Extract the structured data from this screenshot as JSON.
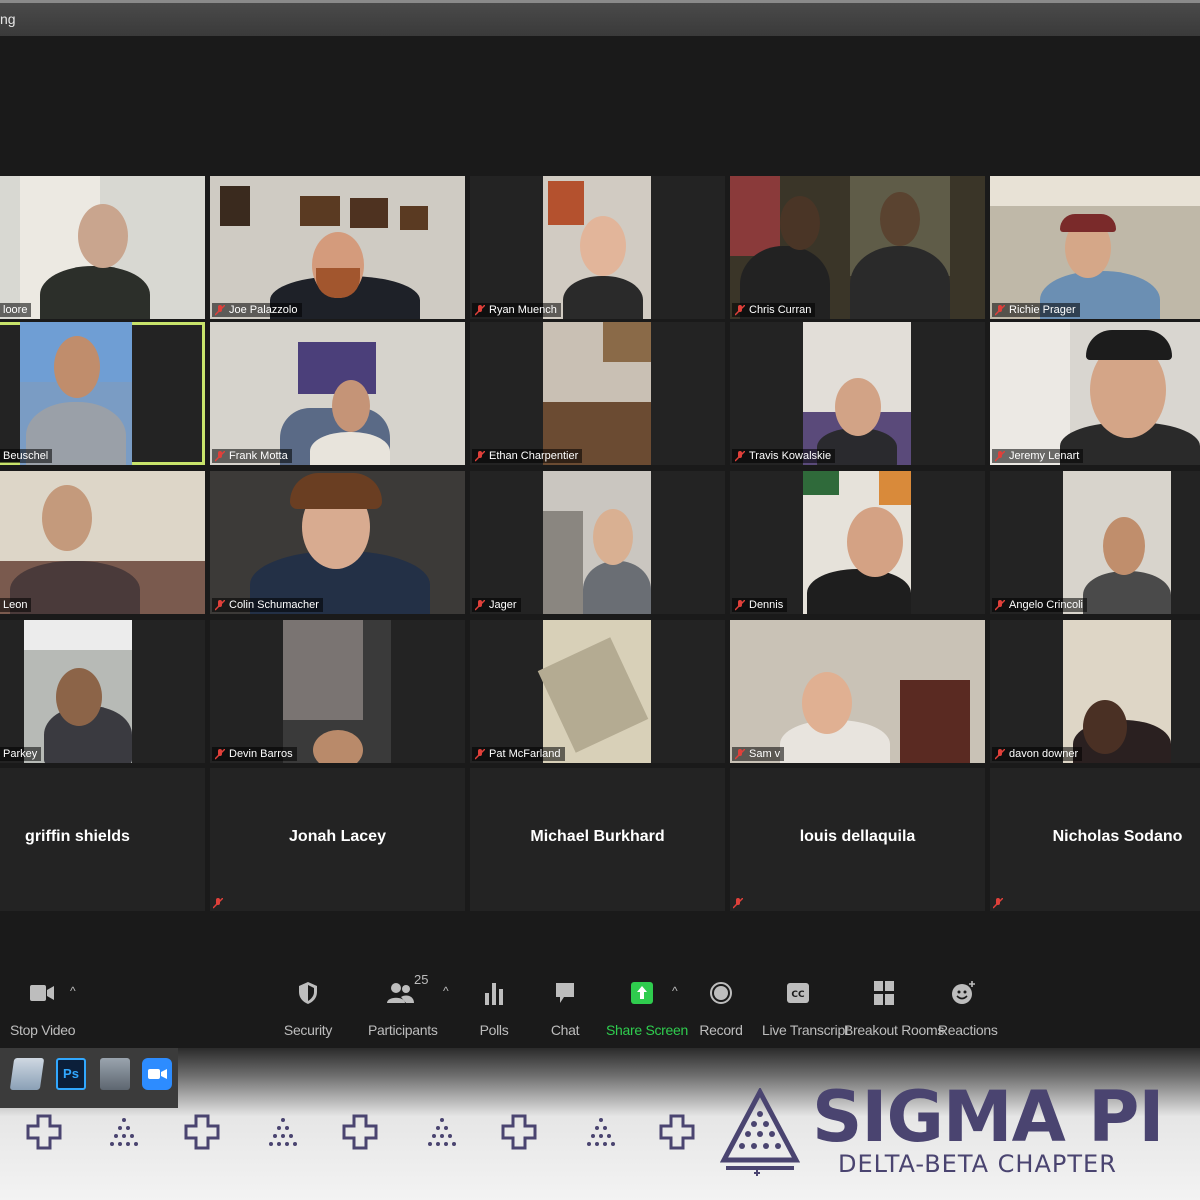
{
  "window": {
    "title": "ng"
  },
  "participants": [
    {
      "name": "loore"
    },
    {
      "name": "Joe Palazzolo"
    },
    {
      "name": "Ryan Muench"
    },
    {
      "name": "Chris Curran"
    },
    {
      "name": "Richie Prager"
    },
    {
      "name": "Beuschel"
    },
    {
      "name": "Frank Motta"
    },
    {
      "name": "Ethan Charpentier"
    },
    {
      "name": "Travis Kowalskie"
    },
    {
      "name": "Jeremy Lenart"
    },
    {
      "name": "Leon"
    },
    {
      "name": "Colin Schumacher"
    },
    {
      "name": "Jager"
    },
    {
      "name": "Dennis"
    },
    {
      "name": "Angelo Crincoli"
    },
    {
      "name": "Parkey"
    },
    {
      "name": "Devin Barros"
    },
    {
      "name": "Pat McFarland"
    },
    {
      "name": "Sam v"
    },
    {
      "name": "davon downer"
    },
    {
      "name": "griffin shields"
    },
    {
      "name": "Jonah Lacey"
    },
    {
      "name": "Michael Burkhard"
    },
    {
      "name": "louis dellaquila"
    },
    {
      "name": "Nicholas Sodano"
    }
  ],
  "toolbar": {
    "stop_video": "Stop Video",
    "security": "Security",
    "participants": "Participants",
    "participants_count": "25",
    "polls": "Polls",
    "chat": "Chat",
    "share_screen": "Share Screen",
    "record": "Record",
    "live_transcript": "Live Transcript",
    "breakout_rooms": "Breakout Rooms",
    "reactions": "Reactions"
  },
  "taskbar": {
    "photoshop": "Ps"
  },
  "brand": {
    "name": "SIGMA PI",
    "chapter": "DELTA-BETA CHAPTER"
  },
  "colors": {
    "accent_green": "#2fcc4e",
    "active_speaker": "#c8e36b",
    "brand_purple": "#4a4470"
  }
}
